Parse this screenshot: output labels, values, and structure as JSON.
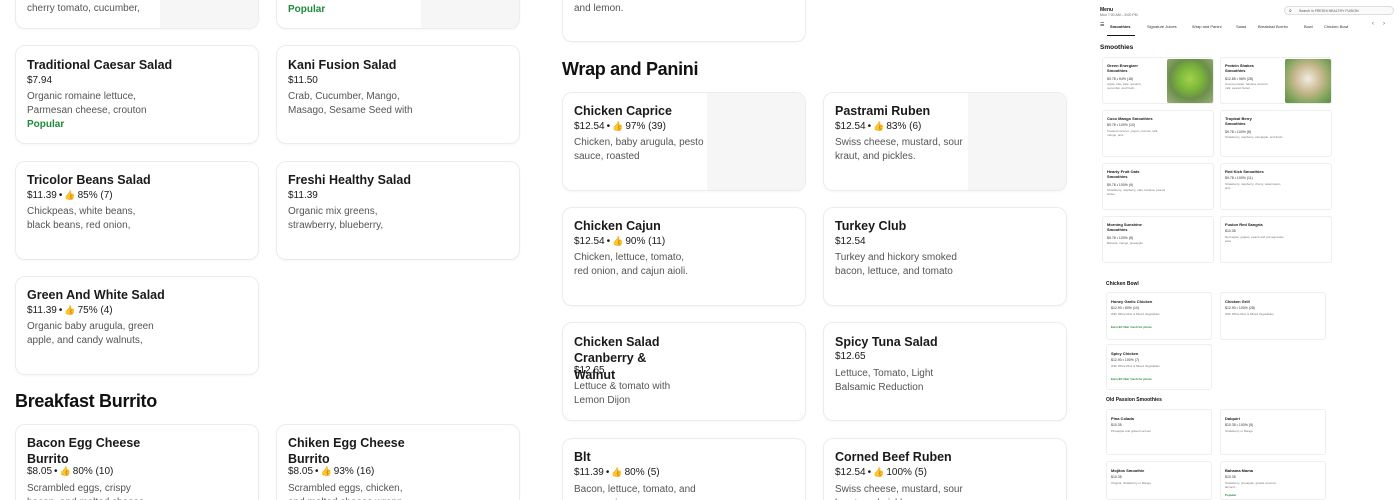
{
  "left_column": {
    "top_card_0": {
      "desc": "cherry tomato, cucumber,"
    },
    "top_card_1": {
      "badge": "Popular"
    },
    "cards": [
      {
        "title": "Traditional Caesar Salad",
        "price": "$7.94",
        "rating": "",
        "desc": "Organic romaine lettuce, Parmesan cheese, crouton",
        "badge": "Popular"
      },
      {
        "title": "Kani Fusion Salad",
        "price": "$11.50",
        "rating": "",
        "desc": "Crab, Cucumber, Mango, Masago, Sesame Seed with",
        "badge": ""
      },
      {
        "title": "Tricolor Beans Salad",
        "price": "$11.39",
        "rating": "85% (7)",
        "desc": "Chickpeas, white beans, black beans, red onion,",
        "badge": ""
      },
      {
        "title": "Freshi Healthy Salad",
        "price": "$11.39",
        "rating": "",
        "desc": "Organic mix greens, strawberry, blueberry,",
        "badge": ""
      },
      {
        "title": "Green And White Salad",
        "price": "$11.39",
        "rating": "75% (4)",
        "desc": "Organic baby arugula, green apple, and candy walnuts,",
        "badge": ""
      }
    ],
    "breakfast_heading": "Breakfast Burrito",
    "breakfast_cards": [
      {
        "title": "Bacon Egg Cheese Burrito",
        "price": "$8.05",
        "rating": "80% (10)",
        "desc": "Scrambled eggs, crispy bacon, and melted cheese"
      },
      {
        "title": "Chiken Egg Cheese Burrito",
        "price": "$8.05",
        "rating": "93% (16)",
        "desc": "Scrambled eggs, chicken, and melted cheese wrapp"
      }
    ]
  },
  "middle_column": {
    "top_card": {
      "desc": "and lemon."
    },
    "heading": "Wrap and Panini",
    "cards": [
      {
        "title": "Chicken Caprice",
        "price": "$12.54",
        "rating": "97% (39)",
        "desc": "Chicken, baby arugula, pesto sauce, roasted"
      },
      {
        "title": "Pastrami Ruben",
        "price": "$12.54",
        "rating": "83% (6)",
        "desc": "Swiss cheese, mustard, sour kraut, and pickles."
      },
      {
        "title": "Chicken Cajun",
        "price": "$12.54",
        "rating": "90% (11)",
        "desc": "Chicken, lettuce, tomato, red onion, and cajun aioli."
      },
      {
        "title": "Turkey Club",
        "price": "$12.54",
        "rating": "",
        "desc": "Turkey and hickory smoked bacon, lettuce, and tomato"
      },
      {
        "title": "Chicken Salad Cranberry & Walnut",
        "price": "$12.65",
        "rating": "",
        "desc": "Lettuce & tomato with Lemon Dijon"
      },
      {
        "title": "Spicy Tuna Salad",
        "price": "$12.65",
        "rating": "",
        "desc": "Lettuce, Tomato, Light Balsamic Reduction"
      },
      {
        "title": "Blt",
        "price": "$11.39",
        "rating": "80% (5)",
        "desc": "Bacon, lettuce, tomato, and mayonnaise"
      },
      {
        "title": "Corned Beef Ruben",
        "price": "$12.54",
        "rating": "100% (5)",
        "desc": "Swiss cheese, mustard, sour kraut, and pickles"
      }
    ]
  },
  "mini_preview": {
    "menu_label": "Menu",
    "hours": "Mon 7:00 AM – 5:00 PM",
    "search_placeholder": "Search in FRESHI HEALTHY FUSION",
    "tabs": [
      "Smoothies",
      "Signature Juices",
      "Wrap and Panini",
      "Salad",
      "Breakfast Burrito",
      "Bowl",
      "Chicken Bowl"
    ],
    "smoothies_heading": "Smoothies",
    "smoothies": [
      {
        "title": "Green Energizer Smoothies",
        "meta": "$9.78 • 94% (18)",
        "desc": "Apple, kiwi, kale, spinach, cucumber, and fresh..."
      },
      {
        "title": "Protein Shakes Smoothies",
        "meta": "$12.85 • 96% (28)",
        "desc": "Cocoa powder, banana, almond milk, peanut butter..."
      },
      {
        "title": "Coco Mango Smoothies",
        "meta": "$9.78 • 100% (10)",
        "desc": "Toasted coconut, yogurt, coconut milk, mango, and..."
      },
      {
        "title": "Tropical Berry Smoothies",
        "meta": "$9.78 • 100% (8)",
        "desc": "Strawberry, raspberry, pineapple, and fresh..."
      },
      {
        "title": "Hearty Fruit Oats Smoothies",
        "meta": "$9.78 • 100% (9)",
        "desc": "Strawberry, raspberry, oats, banana, peanut butter..."
      },
      {
        "title": "Red Kick Smoothies",
        "meta": "$9.78 • 100% (11)",
        "desc": "Strawberry, raspberry, cherry, watermelon, and..."
      },
      {
        "title": "Morning Sunshine Smoothies",
        "meta": "$9.78 • 100% (8)",
        "desc": "Banana, mango, pineapple"
      },
      {
        "title": "Fusion Red Sangria",
        "meta": "$10.35",
        "desc": "Red apple, grapes, peach and pomegranate juice"
      }
    ],
    "chicken_bowl_heading": "Chicken Bowl",
    "chicken_bowl": [
      {
        "title": "Honey Garlic Chicken",
        "meta": "$12.90 • 80% (10)",
        "desc": "With White Rice & Mixed Vegetables",
        "promo": "Earn $3 Uber Cash for photo"
      },
      {
        "title": "Chicken Grill",
        "meta": "$12.90 • 100% (28)",
        "desc": "With White Rice & Mixed Vegetables",
        "promo": ""
      },
      {
        "title": "Spicy Chicken",
        "meta": "$12.90 • 100% (7)",
        "desc": "With White Rice & Mixed Vegetables",
        "promo": "Earn $3 Uber Cash for photo"
      }
    ],
    "old_passion_heading": "Old Passion Smoothies",
    "old_passion": [
      {
        "title": "Pina Colada",
        "meta": "$10.35",
        "desc": "Pineapple and grated coconut"
      },
      {
        "title": "Daiquiri",
        "meta": "$10.35 • 100% (5)",
        "desc": "Strawberry or Mango"
      },
      {
        "title": "Mojitos Smoothie",
        "meta": "$10.35",
        "desc": "Original, Strawberry or Mango"
      },
      {
        "title": "Bahama Mama",
        "meta": "$10.35",
        "desc": "Strawberry, pineapple, grated coconut, almond...",
        "badge": "Popular"
      }
    ],
    "colors": {
      "popular": "#1f8a3a",
      "promo": "#1f8a3a"
    }
  }
}
